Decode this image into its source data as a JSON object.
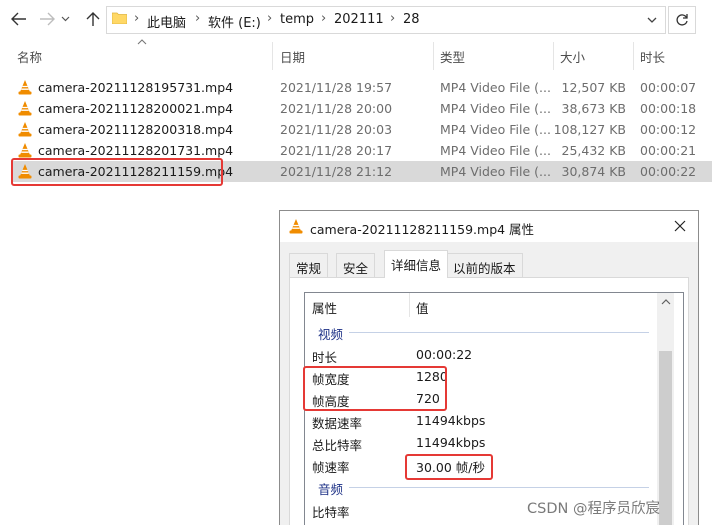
{
  "address_bar": {
    "crumbs": [
      "此电脑",
      "软件 (E:)",
      "temp",
      "202111",
      "28"
    ]
  },
  "columns": {
    "name": "名称",
    "date": "日期",
    "type": "类型",
    "size": "大小",
    "duration": "时长"
  },
  "files": [
    {
      "name": "camera-20211128195731.mp4",
      "date": "2021/11/28 19:57",
      "type": "MP4 Video File (...",
      "size": "12,507 KB",
      "duration": "00:00:07",
      "selected": false
    },
    {
      "name": "camera-20211128200021.mp4",
      "date": "2021/11/28 20:00",
      "type": "MP4 Video File (...",
      "size": "38,673 KB",
      "duration": "00:00:18",
      "selected": false
    },
    {
      "name": "camera-20211128200318.mp4",
      "date": "2021/11/28 20:03",
      "type": "MP4 Video File (...",
      "size": "108,127 KB",
      "duration": "00:00:12",
      "selected": false
    },
    {
      "name": "camera-20211128201731.mp4",
      "date": "2021/11/28 20:17",
      "type": "MP4 Video File (...",
      "size": "25,432 KB",
      "duration": "00:00:21",
      "selected": false
    },
    {
      "name": "camera-20211128211159.mp4",
      "date": "2021/11/28 21:12",
      "type": "MP4 Video File (...",
      "size": "30,874 KB",
      "duration": "00:00:22",
      "selected": true
    }
  ],
  "dialog": {
    "title": "camera-20211128211159.mp4 属性",
    "tabs": [
      "常规",
      "安全",
      "详细信息",
      "以前的版本"
    ],
    "active_tab": "详细信息",
    "header_property": "属性",
    "header_value": "值",
    "group_video": "视频",
    "group_audio": "音频",
    "properties": [
      {
        "name": "时长",
        "value": "00:00:22"
      },
      {
        "name": "帧宽度",
        "value": "1280"
      },
      {
        "name": "帧高度",
        "value": "720"
      },
      {
        "name": "数据速率",
        "value": "11494kbps"
      },
      {
        "name": "总比特率",
        "value": "11494kbps"
      },
      {
        "name": "帧速率",
        "value": "30.00 帧/秒"
      }
    ],
    "audio_properties": [
      {
        "name": "比特率",
        "value": ""
      }
    ]
  },
  "watermark": "CSDN @程序员欣宸",
  "colors": {
    "highlight": "#e53935",
    "selected_row": "#d9d9d9",
    "vlc_orange": "#f08c00",
    "group_text": "#1e3287"
  }
}
